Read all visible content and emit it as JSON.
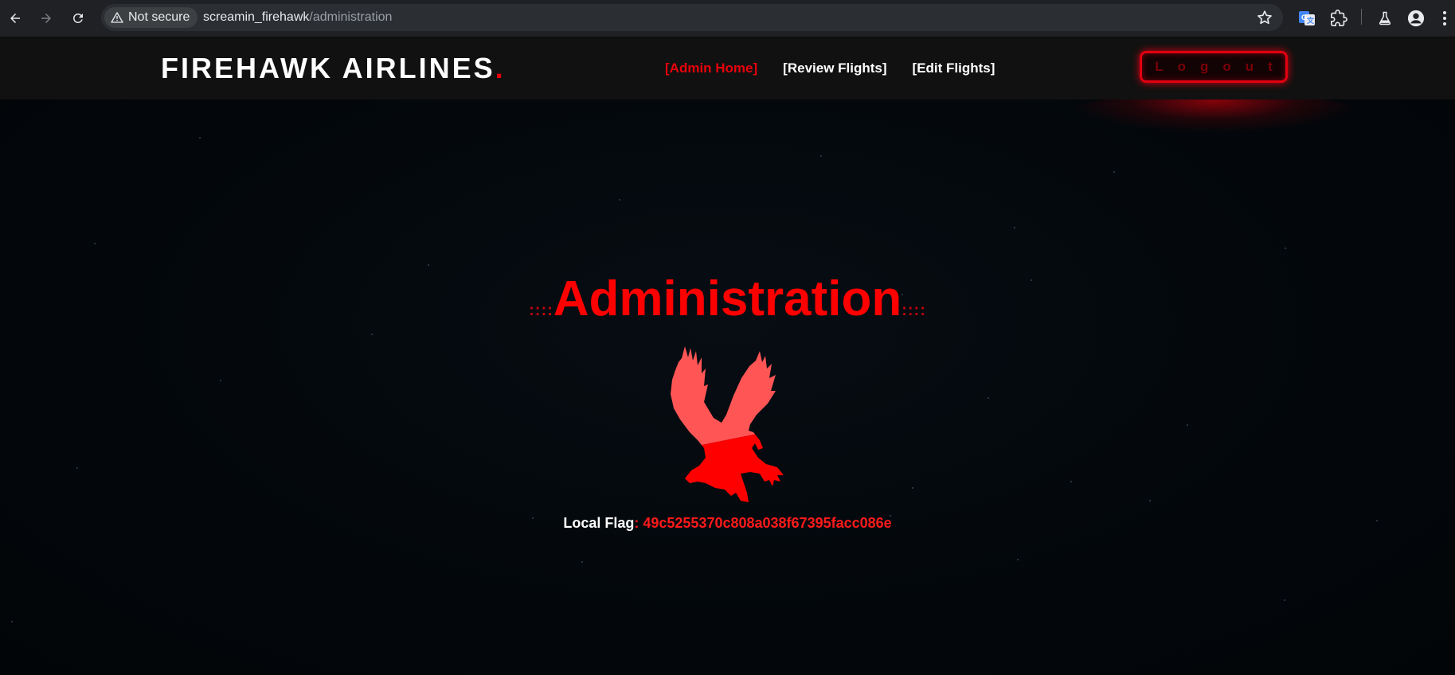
{
  "browser": {
    "security_label": "Not secure",
    "url_host": "screamin_firehawk",
    "url_path": "/administration",
    "icons": [
      "back-arrow-icon",
      "forward-arrow-icon",
      "reload-icon",
      "warning-triangle-icon",
      "bookmark-star-icon",
      "google-translate-icon",
      "extensions-puzzle-icon",
      "labs-flask-icon",
      "profile-icon",
      "more-menu-icon"
    ]
  },
  "header": {
    "logo_text": "FIREHAWK AIRLINES",
    "logo_dot": ".",
    "nav": [
      {
        "label": "[Admin Home]",
        "active": true
      },
      {
        "label": "[Review Flights]",
        "active": false
      },
      {
        "label": "[Edit Flights]",
        "active": false
      }
    ],
    "logout_label": "Logout"
  },
  "main": {
    "title": "Administration",
    "title_deco_left": "::::",
    "title_deco_right": "::::",
    "flag_label": "Local Flag",
    "flag_separator": ":",
    "flag_value": "49c5255370c808a038f67395facc086e"
  },
  "colors": {
    "accent_red": "#ff0000",
    "background": "#03070b",
    "header_bg": "#111111",
    "chrome_bg": "#202124"
  }
}
